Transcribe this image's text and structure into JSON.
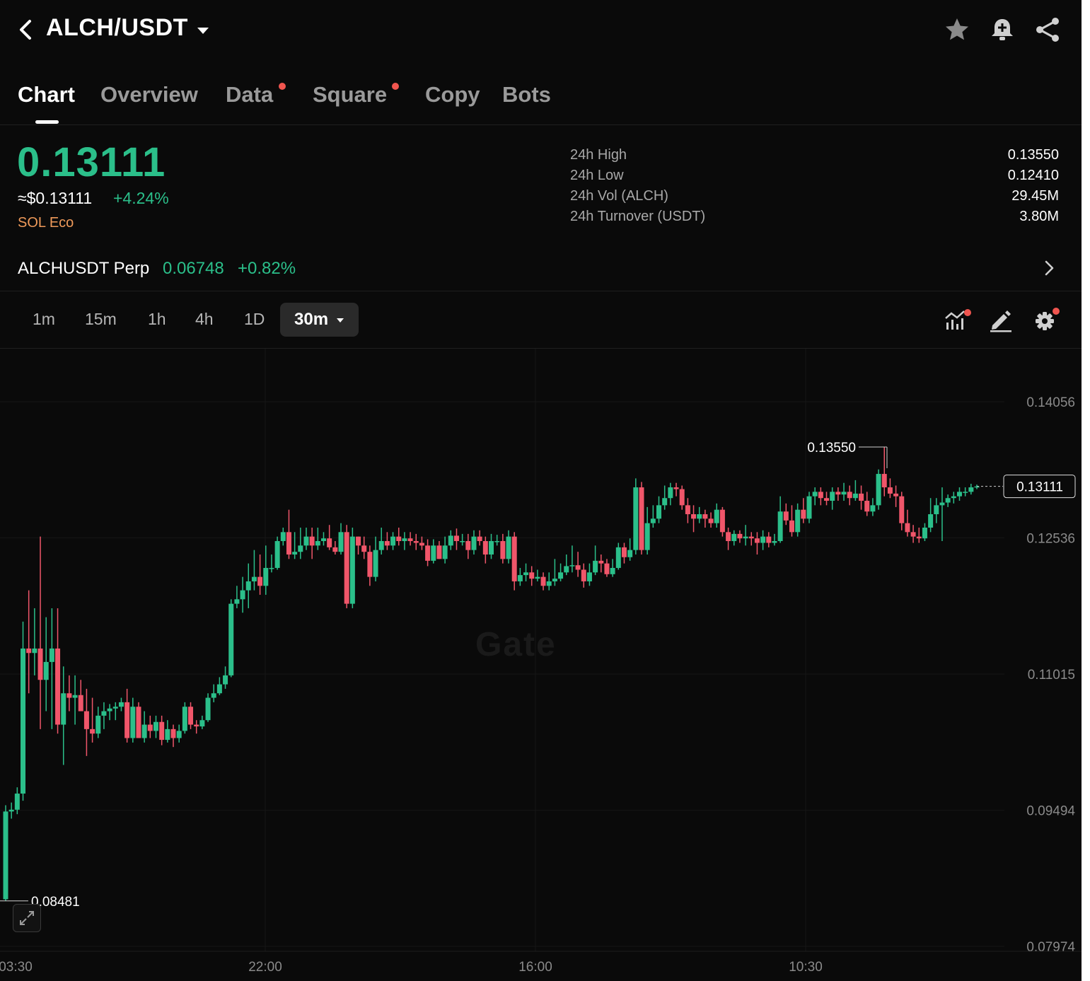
{
  "header": {
    "pair": "ALCH/USDT"
  },
  "tabs": [
    {
      "label": "Chart",
      "active": true,
      "dot": false
    },
    {
      "label": "Overview",
      "active": false,
      "dot": false
    },
    {
      "label": "Data",
      "active": false,
      "dot": true
    },
    {
      "label": "Square",
      "active": false,
      "dot": true
    },
    {
      "label": "Copy",
      "active": false,
      "dot": false
    },
    {
      "label": "Bots",
      "active": false,
      "dot": false
    }
  ],
  "ticker": {
    "last_price": "0.13111",
    "usd_price": "≈$0.13111",
    "change_pct": "+4.24%",
    "tag": "SOL Eco"
  },
  "stats": [
    {
      "label": "24h High",
      "value": "0.13550"
    },
    {
      "label": "24h Low",
      "value": "0.12410"
    },
    {
      "label": "24h Vol (ALCH)",
      "value": "29.45M"
    },
    {
      "label": "24h Turnover (USDT)",
      "value": "3.80M"
    }
  ],
  "perp": {
    "name": "ALCHUSDT Perp",
    "price": "0.06748",
    "change": "+0.82%"
  },
  "intervals": [
    "1m",
    "15m",
    "1h",
    "4h",
    "1D"
  ],
  "active_interval": "30m",
  "chart_watermark": "Gate",
  "colors": {
    "up": "#2bbf8a",
    "down": "#f0566a",
    "accent_dot": "#f0554f"
  },
  "chart_data": {
    "type": "candlestick",
    "yticks": [
      {
        "v": 0.14056,
        "label": "0.14056"
      },
      {
        "v": 0.12536,
        "label": "0.12536"
      },
      {
        "v": 0.11015,
        "label": "0.11015"
      },
      {
        "v": 0.09494,
        "label": "0.09494"
      },
      {
        "v": 0.07974,
        "label": "0.07974"
      }
    ],
    "xticks": [
      "03:30",
      "22:00",
      "16:00",
      "10:30"
    ],
    "high_marker": "0.13550",
    "low_marker": "0.08481",
    "last_price_label": "0.13111",
    "last_price": 0.13111,
    "high_value": 0.1355,
    "low_value": 0.08481,
    "candles": [
      [
        0.085,
        0.0948,
        0.0848,
        0.0955
      ],
      [
        0.0948,
        0.095,
        0.094,
        0.0958
      ],
      [
        0.095,
        0.0968,
        0.0945,
        0.0975
      ],
      [
        0.0968,
        0.113,
        0.096,
        0.116
      ],
      [
        0.113,
        0.1125,
        0.108,
        0.1195
      ],
      [
        0.1125,
        0.113,
        0.11,
        0.1175
      ],
      [
        0.113,
        0.1095,
        0.104,
        0.1255
      ],
      [
        0.1095,
        0.1115,
        0.106,
        0.1165
      ],
      [
        0.1115,
        0.113,
        0.104,
        0.1175
      ],
      [
        0.113,
        0.1045,
        0.1035,
        0.1175
      ],
      [
        0.1045,
        0.108,
        0.1,
        0.111
      ],
      [
        0.108,
        0.1075,
        0.106,
        0.11
      ],
      [
        0.1075,
        0.1078,
        0.1045,
        0.11
      ],
      [
        0.1078,
        0.106,
        0.106,
        0.1095
      ],
      [
        0.106,
        0.104,
        0.101,
        0.1085
      ],
      [
        0.104,
        0.1035,
        0.1025,
        0.1075
      ],
      [
        0.1035,
        0.1055,
        0.103,
        0.1065
      ],
      [
        0.1055,
        0.106,
        0.104,
        0.107
      ],
      [
        0.106,
        0.1063,
        0.105,
        0.1068
      ],
      [
        0.1063,
        0.1065,
        0.105,
        0.107
      ],
      [
        0.1065,
        0.107,
        0.106,
        0.1075
      ],
      [
        0.107,
        0.103,
        0.1025,
        0.1085
      ],
      [
        0.103,
        0.1065,
        0.1025,
        0.1075
      ],
      [
        0.1065,
        0.103,
        0.103,
        0.107
      ],
      [
        0.103,
        0.1045,
        0.1025,
        0.106
      ],
      [
        0.1045,
        0.1038,
        0.103,
        0.1055
      ],
      [
        0.1038,
        0.1048,
        0.103,
        0.1055
      ],
      [
        0.1048,
        0.1028,
        0.1022,
        0.1055
      ],
      [
        0.1028,
        0.104,
        0.1025,
        0.105
      ],
      [
        0.104,
        0.103,
        0.102,
        0.1045
      ],
      [
        0.103,
        0.1038,
        0.1025,
        0.1045
      ],
      [
        0.1038,
        0.1065,
        0.1035,
        0.107
      ],
      [
        0.1065,
        0.1045,
        0.104,
        0.107
      ],
      [
        0.1045,
        0.1043,
        0.1035,
        0.105
      ],
      [
        0.1043,
        0.105,
        0.104,
        0.1055
      ],
      [
        0.105,
        0.1075,
        0.1048,
        0.108
      ],
      [
        0.1075,
        0.108,
        0.107,
        0.109
      ],
      [
        0.108,
        0.109,
        0.1078,
        0.1098
      ],
      [
        0.109,
        0.11,
        0.1085,
        0.111
      ],
      [
        0.11,
        0.118,
        0.1098,
        0.1185
      ],
      [
        0.118,
        0.1185,
        0.1175,
        0.12
      ],
      [
        0.1185,
        0.1195,
        0.117,
        0.121
      ],
      [
        0.1195,
        0.1205,
        0.1175,
        0.1225
      ],
      [
        0.1205,
        0.121,
        0.1195,
        0.124
      ],
      [
        0.121,
        0.12,
        0.119,
        0.1235
      ],
      [
        0.12,
        0.122,
        0.119,
        0.1245
      ],
      [
        0.122,
        0.122,
        0.1215,
        0.1235
      ],
      [
        0.122,
        0.125,
        0.1218,
        0.1255
      ],
      [
        0.125,
        0.126,
        0.1245,
        0.1265
      ],
      [
        0.126,
        0.1235,
        0.123,
        0.1285
      ],
      [
        0.1235,
        0.1238,
        0.123,
        0.126
      ],
      [
        0.1238,
        0.1245,
        0.123,
        0.1265
      ],
      [
        0.1245,
        0.1255,
        0.124,
        0.1265
      ],
      [
        0.1255,
        0.1245,
        0.123,
        0.1265
      ],
      [
        0.1245,
        0.125,
        0.124,
        0.1265
      ],
      [
        0.125,
        0.1253,
        0.1245,
        0.126
      ],
      [
        0.1253,
        0.1243,
        0.124,
        0.1268
      ],
      [
        0.1243,
        0.1238,
        0.1235,
        0.125
      ],
      [
        0.1238,
        0.126,
        0.1235,
        0.127
      ],
      [
        0.126,
        0.118,
        0.1175,
        0.1268
      ],
      [
        0.118,
        0.1255,
        0.1175,
        0.1265
      ],
      [
        0.1255,
        0.1245,
        0.1235,
        0.1255
      ],
      [
        0.1245,
        0.1238,
        0.123,
        0.1255
      ],
      [
        0.1238,
        0.121,
        0.12,
        0.1245
      ],
      [
        0.121,
        0.124,
        0.1205,
        0.1255
      ],
      [
        0.124,
        0.125,
        0.1235,
        0.1265
      ],
      [
        0.125,
        0.1245,
        0.124,
        0.126
      ],
      [
        0.1245,
        0.1255,
        0.124,
        0.126
      ],
      [
        0.1255,
        0.125,
        0.1245,
        0.1265
      ],
      [
        0.125,
        0.1253,
        0.124,
        0.126
      ],
      [
        0.1253,
        0.125,
        0.1245,
        0.126
      ],
      [
        0.125,
        0.1248,
        0.124,
        0.1258
      ],
      [
        0.1248,
        0.1245,
        0.124,
        0.1255
      ],
      [
        0.1245,
        0.1228,
        0.1222,
        0.1252
      ],
      [
        0.1228,
        0.1245,
        0.1225,
        0.1252
      ],
      [
        0.1245,
        0.123,
        0.123,
        0.125
      ],
      [
        0.123,
        0.1245,
        0.1225,
        0.1255
      ],
      [
        0.1245,
        0.1256,
        0.124,
        0.1262
      ],
      [
        0.1256,
        0.125,
        0.124,
        0.1264
      ],
      [
        0.125,
        0.125,
        0.1245,
        0.1258
      ],
      [
        0.125,
        0.124,
        0.123,
        0.1258
      ],
      [
        0.124,
        0.1255,
        0.1235,
        0.1262
      ],
      [
        0.1255,
        0.125,
        0.1245,
        0.1262
      ],
      [
        0.125,
        0.1235,
        0.1225,
        0.1255
      ],
      [
        0.1235,
        0.125,
        0.123,
        0.1258
      ],
      [
        0.125,
        0.125,
        0.1245,
        0.1257
      ],
      [
        0.125,
        0.123,
        0.1225,
        0.1258
      ],
      [
        0.123,
        0.1255,
        0.1225,
        0.1262
      ],
      [
        0.1255,
        0.1205,
        0.1195,
        0.126
      ],
      [
        0.1205,
        0.1212,
        0.12,
        0.122
      ],
      [
        0.1212,
        0.1215,
        0.1205,
        0.1225
      ],
      [
        0.1215,
        0.1208,
        0.12,
        0.1222
      ],
      [
        0.1208,
        0.121,
        0.1205,
        0.1218
      ],
      [
        0.121,
        0.12,
        0.1195,
        0.1215
      ],
      [
        0.12,
        0.1205,
        0.1195,
        0.1215
      ],
      [
        0.1205,
        0.1208,
        0.12,
        0.123
      ],
      [
        0.1208,
        0.1215,
        0.1205,
        0.1225
      ],
      [
        0.1215,
        0.1222,
        0.1212,
        0.1235
      ],
      [
        0.1222,
        0.1223,
        0.1215,
        0.1245
      ],
      [
        0.1223,
        0.1218,
        0.121,
        0.1238
      ],
      [
        0.1218,
        0.1205,
        0.1198,
        0.1225
      ],
      [
        0.1205,
        0.1215,
        0.12,
        0.1225
      ],
      [
        0.1215,
        0.1228,
        0.1212,
        0.1245
      ],
      [
        0.1228,
        0.1225,
        0.1215,
        0.1235
      ],
      [
        0.1225,
        0.1213,
        0.121,
        0.123
      ],
      [
        0.1213,
        0.122,
        0.121,
        0.123
      ],
      [
        0.122,
        0.1243,
        0.1218,
        0.1248
      ],
      [
        0.1243,
        0.1232,
        0.1225,
        0.1248
      ],
      [
        0.1232,
        0.124,
        0.1228,
        0.1253
      ],
      [
        0.124,
        0.131,
        0.1235,
        0.132
      ],
      [
        0.131,
        0.124,
        0.1235,
        0.1316
      ],
      [
        0.124,
        0.127,
        0.1235,
        0.1288
      ],
      [
        0.127,
        0.1275,
        0.1265,
        0.129
      ],
      [
        0.1275,
        0.129,
        0.127,
        0.13
      ],
      [
        0.129,
        0.1298,
        0.1285,
        0.1312
      ],
      [
        0.1298,
        0.131,
        0.129,
        0.1315
      ],
      [
        0.131,
        0.1308,
        0.13,
        0.1315
      ],
      [
        0.1308,
        0.129,
        0.1285,
        0.1312
      ],
      [
        0.129,
        0.128,
        0.127,
        0.1298
      ],
      [
        0.128,
        0.1275,
        0.126,
        0.129
      ],
      [
        0.1275,
        0.128,
        0.127,
        0.1288
      ],
      [
        0.128,
        0.1275,
        0.1265,
        0.1285
      ],
      [
        0.1275,
        0.127,
        0.1265,
        0.1282
      ],
      [
        0.127,
        0.1285,
        0.1265,
        0.1292
      ],
      [
        0.1285,
        0.126,
        0.1255,
        0.1288
      ],
      [
        0.126,
        0.125,
        0.124,
        0.1265
      ],
      [
        0.125,
        0.1258,
        0.1245,
        0.1262
      ],
      [
        0.1258,
        0.1253,
        0.1248,
        0.1262
      ],
      [
        0.1253,
        0.1255,
        0.1245,
        0.1268
      ],
      [
        0.1255,
        0.1253,
        0.1245,
        0.126
      ],
      [
        0.1253,
        0.1248,
        0.1235,
        0.126
      ],
      [
        0.1248,
        0.1255,
        0.124,
        0.1262
      ],
      [
        0.1255,
        0.1248,
        0.1243,
        0.126
      ],
      [
        0.1248,
        0.125,
        0.1245,
        0.1258
      ],
      [
        0.125,
        0.1283,
        0.1248,
        0.13
      ],
      [
        0.1283,
        0.1273,
        0.1268,
        0.1292
      ],
      [
        0.1273,
        0.126,
        0.1255,
        0.129
      ],
      [
        0.126,
        0.1285,
        0.1255,
        0.1292
      ],
      [
        0.1285,
        0.1275,
        0.127,
        0.1298
      ],
      [
        0.1275,
        0.13,
        0.127,
        0.1305
      ],
      [
        0.13,
        0.1305,
        0.129,
        0.131
      ],
      [
        0.1305,
        0.1298,
        0.129,
        0.131
      ],
      [
        0.1298,
        0.1295,
        0.129,
        0.1305
      ],
      [
        0.1295,
        0.1305,
        0.1285,
        0.131
      ],
      [
        0.1305,
        0.1302,
        0.1295,
        0.131
      ],
      [
        0.1302,
        0.1305,
        0.1295,
        0.1315
      ],
      [
        0.1305,
        0.1298,
        0.129,
        0.1312
      ],
      [
        0.1298,
        0.1303,
        0.1295,
        0.1318
      ],
      [
        0.1303,
        0.1295,
        0.1285,
        0.1312
      ],
      [
        0.1295,
        0.1283,
        0.1278,
        0.1305
      ],
      [
        0.1283,
        0.129,
        0.1278,
        0.1298
      ],
      [
        0.129,
        0.1325,
        0.1285,
        0.133
      ],
      [
        0.1325,
        0.131,
        0.13,
        0.1355
      ],
      [
        0.131,
        0.1303,
        0.1298,
        0.132
      ],
      [
        0.1303,
        0.13,
        0.1288,
        0.1312
      ],
      [
        0.13,
        0.127,
        0.1262,
        0.1305
      ],
      [
        0.127,
        0.126,
        0.1255,
        0.1285
      ],
      [
        0.126,
        0.1255,
        0.1248,
        0.1268
      ],
      [
        0.1255,
        0.1253,
        0.1248,
        0.1265
      ],
      [
        0.1253,
        0.1265,
        0.125,
        0.127
      ],
      [
        0.1265,
        0.128,
        0.126,
        0.1298
      ],
      [
        0.128,
        0.129,
        0.127,
        0.1298
      ],
      [
        0.129,
        0.1293,
        0.125,
        0.131
      ],
      [
        0.1293,
        0.1298,
        0.1288,
        0.1302
      ],
      [
        0.1298,
        0.13,
        0.1292,
        0.1305
      ],
      [
        0.13,
        0.1305,
        0.1295,
        0.131
      ],
      [
        0.1305,
        0.1305,
        0.13,
        0.131
      ],
      [
        0.1305,
        0.131,
        0.1302,
        0.1314
      ],
      [
        0.131,
        0.1311,
        0.1308,
        0.1313
      ]
    ]
  }
}
